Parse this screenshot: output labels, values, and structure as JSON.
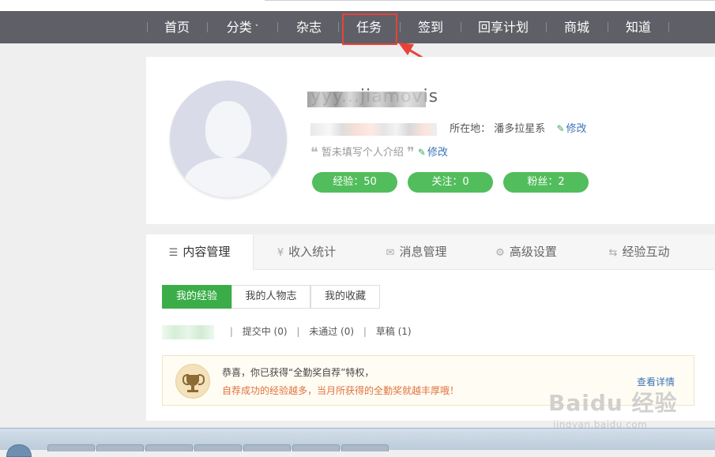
{
  "nav": {
    "items": [
      {
        "label": "首页"
      },
      {
        "label": "分类"
      },
      {
        "label": "杂志"
      },
      {
        "label": "任务"
      },
      {
        "label": "签到"
      },
      {
        "label": "回享计划"
      },
      {
        "label": "商城"
      },
      {
        "label": "知道"
      }
    ],
    "dropdown_caret": "˅"
  },
  "profile": {
    "username": "yyy...jiamovis",
    "location_label": "所在地：",
    "location_value": "潘多拉星系",
    "edit_label": "修改",
    "intro_placeholder": "暂未填写个人介绍",
    "intro_edit_label": "修改",
    "quote_open": "❝",
    "quote_close": "❞",
    "stats": [
      {
        "label": "经验：50"
      },
      {
        "label": "关注：0"
      },
      {
        "label": "粉丝：2"
      }
    ]
  },
  "panel": {
    "tabs": [
      {
        "icon": "☰",
        "label": "内容管理"
      },
      {
        "icon": "¥",
        "label": "收入统计"
      },
      {
        "icon": "✉",
        "label": "消息管理"
      },
      {
        "icon": "⚙",
        "label": "高级设置"
      },
      {
        "icon": "⇆",
        "label": "经验互动"
      }
    ],
    "subtabs": [
      {
        "label": "我的经验"
      },
      {
        "label": "我的人物志"
      },
      {
        "label": "我的收藏"
      }
    ],
    "filters": [
      {
        "label": "提交中 (0)"
      },
      {
        "label": "未通过 (0)"
      },
      {
        "label": "草稿 (1)"
      }
    ],
    "filter_sep": "|",
    "notice": {
      "line1": "恭喜，你已获得“全勤奖自荐”特权，",
      "line2": "自荐成功的经验越多，当月所获得的全勤奖就越丰厚哦！",
      "detail_label": "查看详情"
    }
  },
  "watermark": {
    "brand": "Baidu 经验",
    "url": "jingyan.baidu.com"
  },
  "colors": {
    "nav_bg": "#5f6067",
    "badge_green": "#52bd5c",
    "active_green": "#3aad48",
    "link_blue": "#3b73b9",
    "highlight_red": "#e8423a"
  }
}
